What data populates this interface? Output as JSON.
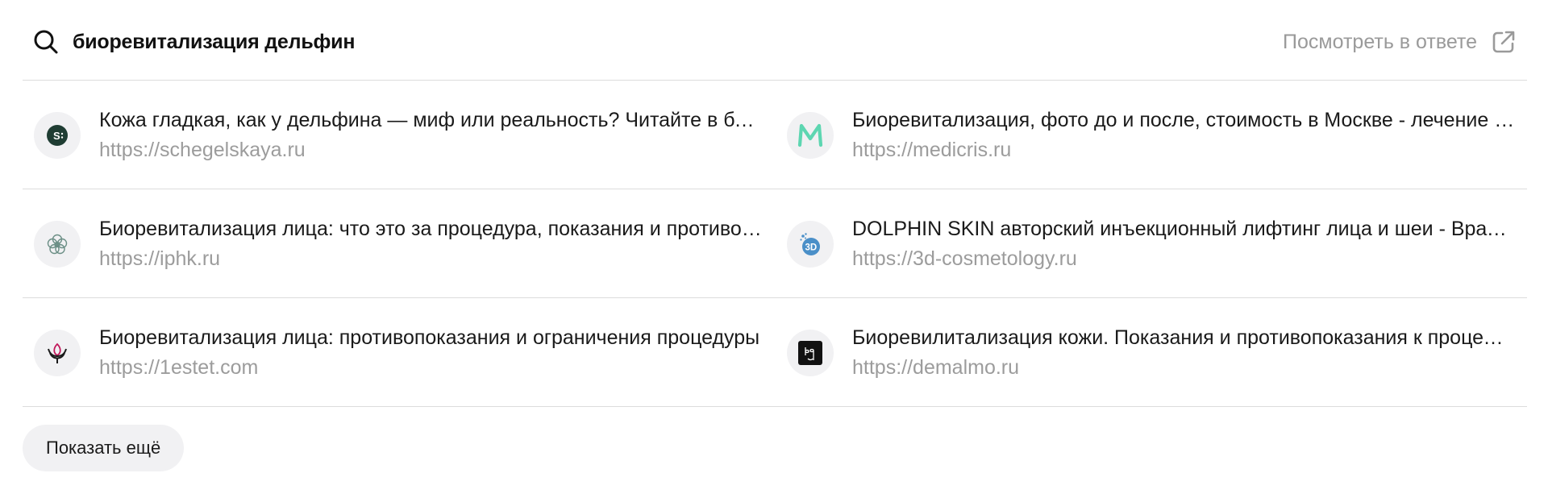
{
  "search": {
    "query": "биоревитализация дельфин",
    "open_link_label": "Посмотреть в ответе"
  },
  "results": [
    {
      "title": "Кожа гладкая, как у дельфина — миф или реальность? Читайте в блоге",
      "url": "https://schegelskaya.ru",
      "icon": "schegelskaya-logo"
    },
    {
      "title": "Биоревитализация, фото до и после, стоимость в Москве - лечение в клинике",
      "url": "https://medicris.ru",
      "icon": "medicris-logo"
    },
    {
      "title": "Биоревитализация лица: что это за процедура, показания и противопоказания",
      "url": "https://iphk.ru",
      "icon": "iphk-logo"
    },
    {
      "title": "DOLPHIN SKIN авторский инъекционный лифтинг лица и шеи - Врач косметолог",
      "url": "https://3d-cosmetology.ru",
      "icon": "3d-cosmetology-logo"
    },
    {
      "title": "Биоревитализация лица: противопоказания и ограничения процедуры",
      "url": "https://1estet.com",
      "icon": "1estet-logo"
    },
    {
      "title": "Биоревилитализация кожи. Показания и противопоказания к процедуре",
      "url": "https://demalmo.ru",
      "icon": "demalmo-logo"
    }
  ],
  "more_button_label": "Показать ещё",
  "colors": {
    "divider": "#dcdcdc",
    "muted_text": "#9c9c9c",
    "favicon_bg": "#f1f1f3",
    "medicris_green": "#5dd6b1",
    "cosmetology_blue": "#4a8fc8"
  }
}
